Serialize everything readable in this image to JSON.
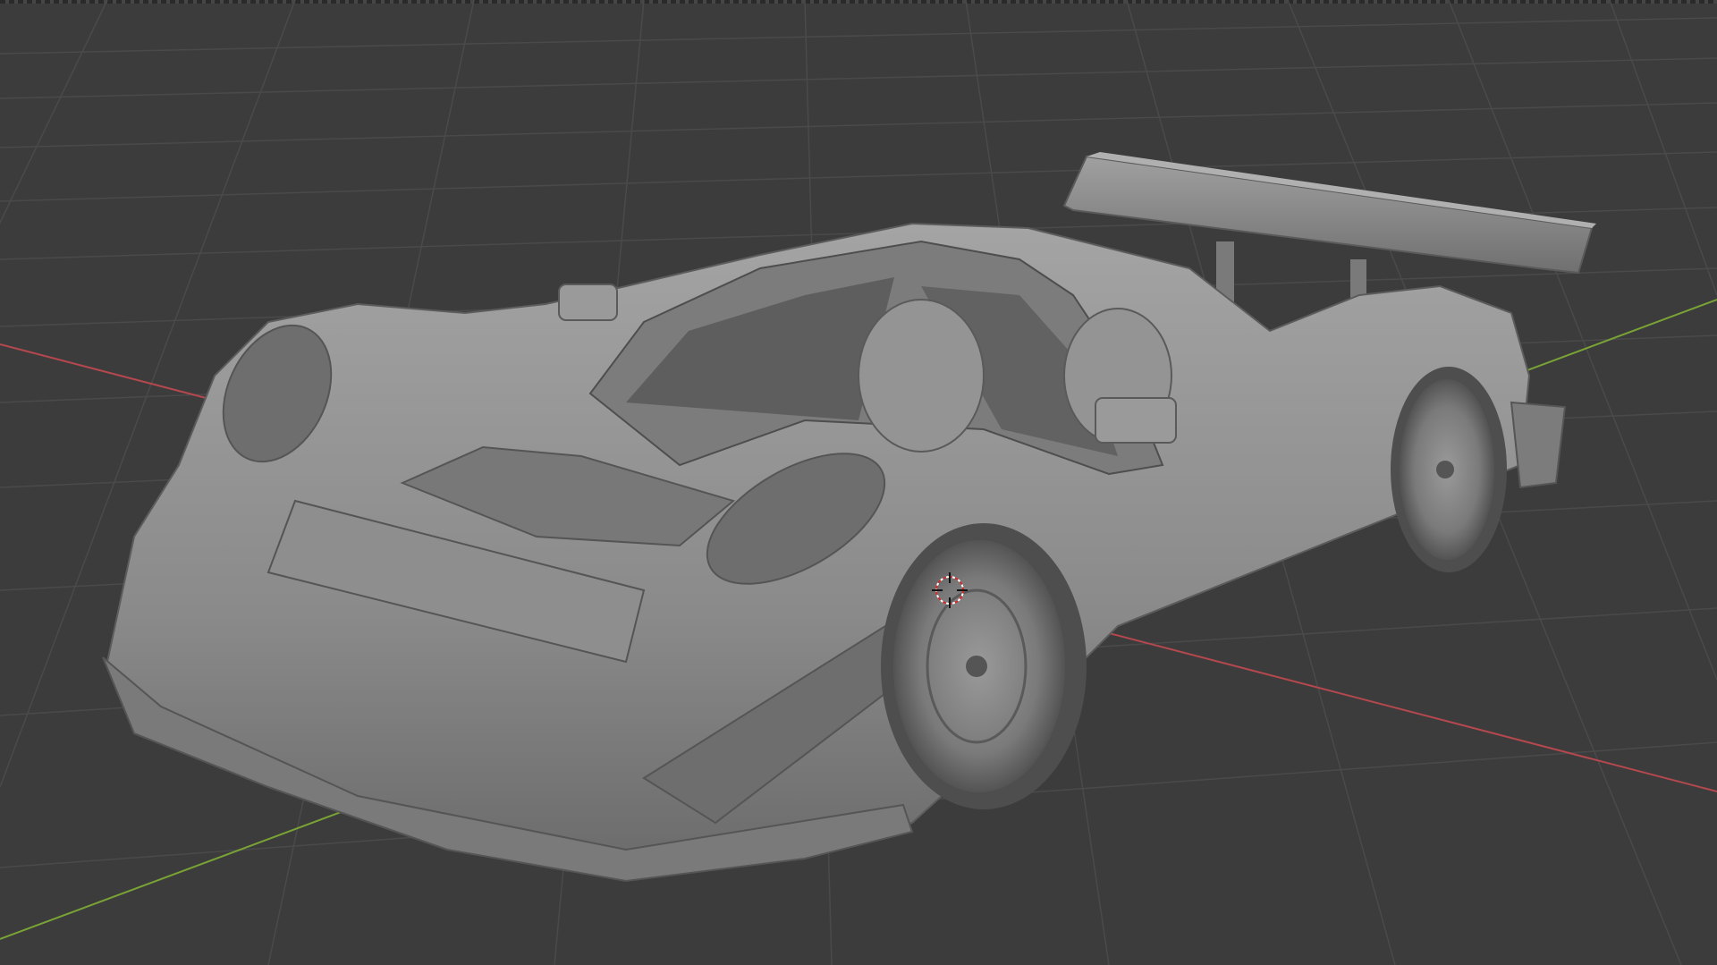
{
  "viewport": {
    "mode": "solid-shading",
    "colors": {
      "background": "#3c3c3c",
      "grid_line": "#4a4a4a",
      "x_axis": "#b4484e",
      "y_axis": "#7aa335",
      "mesh": "#8c8c8c",
      "mesh_dark": "#5f5f5f",
      "mesh_light": "#a8a8a8"
    },
    "object": "race-car-mesh",
    "cursor": "3d-cursor-icon"
  }
}
